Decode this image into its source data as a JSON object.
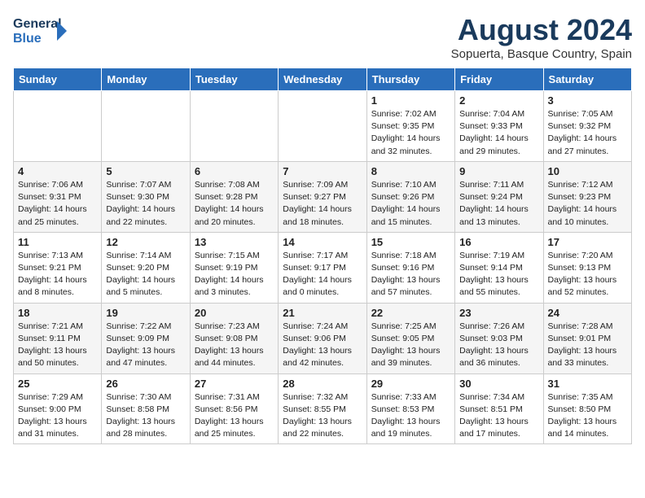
{
  "header": {
    "logo_line1": "General",
    "logo_line2": "Blue",
    "month": "August 2024",
    "location": "Sopuerta, Basque Country, Spain"
  },
  "weekdays": [
    "Sunday",
    "Monday",
    "Tuesday",
    "Wednesday",
    "Thursday",
    "Friday",
    "Saturday"
  ],
  "weeks": [
    [
      {
        "day": "",
        "info": ""
      },
      {
        "day": "",
        "info": ""
      },
      {
        "day": "",
        "info": ""
      },
      {
        "day": "",
        "info": ""
      },
      {
        "day": "1",
        "info": "Sunrise: 7:02 AM\nSunset: 9:35 PM\nDaylight: 14 hours\nand 32 minutes."
      },
      {
        "day": "2",
        "info": "Sunrise: 7:04 AM\nSunset: 9:33 PM\nDaylight: 14 hours\nand 29 minutes."
      },
      {
        "day": "3",
        "info": "Sunrise: 7:05 AM\nSunset: 9:32 PM\nDaylight: 14 hours\nand 27 minutes."
      }
    ],
    [
      {
        "day": "4",
        "info": "Sunrise: 7:06 AM\nSunset: 9:31 PM\nDaylight: 14 hours\nand 25 minutes."
      },
      {
        "day": "5",
        "info": "Sunrise: 7:07 AM\nSunset: 9:30 PM\nDaylight: 14 hours\nand 22 minutes."
      },
      {
        "day": "6",
        "info": "Sunrise: 7:08 AM\nSunset: 9:28 PM\nDaylight: 14 hours\nand 20 minutes."
      },
      {
        "day": "7",
        "info": "Sunrise: 7:09 AM\nSunset: 9:27 PM\nDaylight: 14 hours\nand 18 minutes."
      },
      {
        "day": "8",
        "info": "Sunrise: 7:10 AM\nSunset: 9:26 PM\nDaylight: 14 hours\nand 15 minutes."
      },
      {
        "day": "9",
        "info": "Sunrise: 7:11 AM\nSunset: 9:24 PM\nDaylight: 14 hours\nand 13 minutes."
      },
      {
        "day": "10",
        "info": "Sunrise: 7:12 AM\nSunset: 9:23 PM\nDaylight: 14 hours\nand 10 minutes."
      }
    ],
    [
      {
        "day": "11",
        "info": "Sunrise: 7:13 AM\nSunset: 9:21 PM\nDaylight: 14 hours\nand 8 minutes."
      },
      {
        "day": "12",
        "info": "Sunrise: 7:14 AM\nSunset: 9:20 PM\nDaylight: 14 hours\nand 5 minutes."
      },
      {
        "day": "13",
        "info": "Sunrise: 7:15 AM\nSunset: 9:19 PM\nDaylight: 14 hours\nand 3 minutes."
      },
      {
        "day": "14",
        "info": "Sunrise: 7:17 AM\nSunset: 9:17 PM\nDaylight: 14 hours\nand 0 minutes."
      },
      {
        "day": "15",
        "info": "Sunrise: 7:18 AM\nSunset: 9:16 PM\nDaylight: 13 hours\nand 57 minutes."
      },
      {
        "day": "16",
        "info": "Sunrise: 7:19 AM\nSunset: 9:14 PM\nDaylight: 13 hours\nand 55 minutes."
      },
      {
        "day": "17",
        "info": "Sunrise: 7:20 AM\nSunset: 9:13 PM\nDaylight: 13 hours\nand 52 minutes."
      }
    ],
    [
      {
        "day": "18",
        "info": "Sunrise: 7:21 AM\nSunset: 9:11 PM\nDaylight: 13 hours\nand 50 minutes."
      },
      {
        "day": "19",
        "info": "Sunrise: 7:22 AM\nSunset: 9:09 PM\nDaylight: 13 hours\nand 47 minutes."
      },
      {
        "day": "20",
        "info": "Sunrise: 7:23 AM\nSunset: 9:08 PM\nDaylight: 13 hours\nand 44 minutes."
      },
      {
        "day": "21",
        "info": "Sunrise: 7:24 AM\nSunset: 9:06 PM\nDaylight: 13 hours\nand 42 minutes."
      },
      {
        "day": "22",
        "info": "Sunrise: 7:25 AM\nSunset: 9:05 PM\nDaylight: 13 hours\nand 39 minutes."
      },
      {
        "day": "23",
        "info": "Sunrise: 7:26 AM\nSunset: 9:03 PM\nDaylight: 13 hours\nand 36 minutes."
      },
      {
        "day": "24",
        "info": "Sunrise: 7:28 AM\nSunset: 9:01 PM\nDaylight: 13 hours\nand 33 minutes."
      }
    ],
    [
      {
        "day": "25",
        "info": "Sunrise: 7:29 AM\nSunset: 9:00 PM\nDaylight: 13 hours\nand 31 minutes."
      },
      {
        "day": "26",
        "info": "Sunrise: 7:30 AM\nSunset: 8:58 PM\nDaylight: 13 hours\nand 28 minutes."
      },
      {
        "day": "27",
        "info": "Sunrise: 7:31 AM\nSunset: 8:56 PM\nDaylight: 13 hours\nand 25 minutes."
      },
      {
        "day": "28",
        "info": "Sunrise: 7:32 AM\nSunset: 8:55 PM\nDaylight: 13 hours\nand 22 minutes."
      },
      {
        "day": "29",
        "info": "Sunrise: 7:33 AM\nSunset: 8:53 PM\nDaylight: 13 hours\nand 19 minutes."
      },
      {
        "day": "30",
        "info": "Sunrise: 7:34 AM\nSunset: 8:51 PM\nDaylight: 13 hours\nand 17 minutes."
      },
      {
        "day": "31",
        "info": "Sunrise: 7:35 AM\nSunset: 8:50 PM\nDaylight: 13 hours\nand 14 minutes."
      }
    ]
  ]
}
